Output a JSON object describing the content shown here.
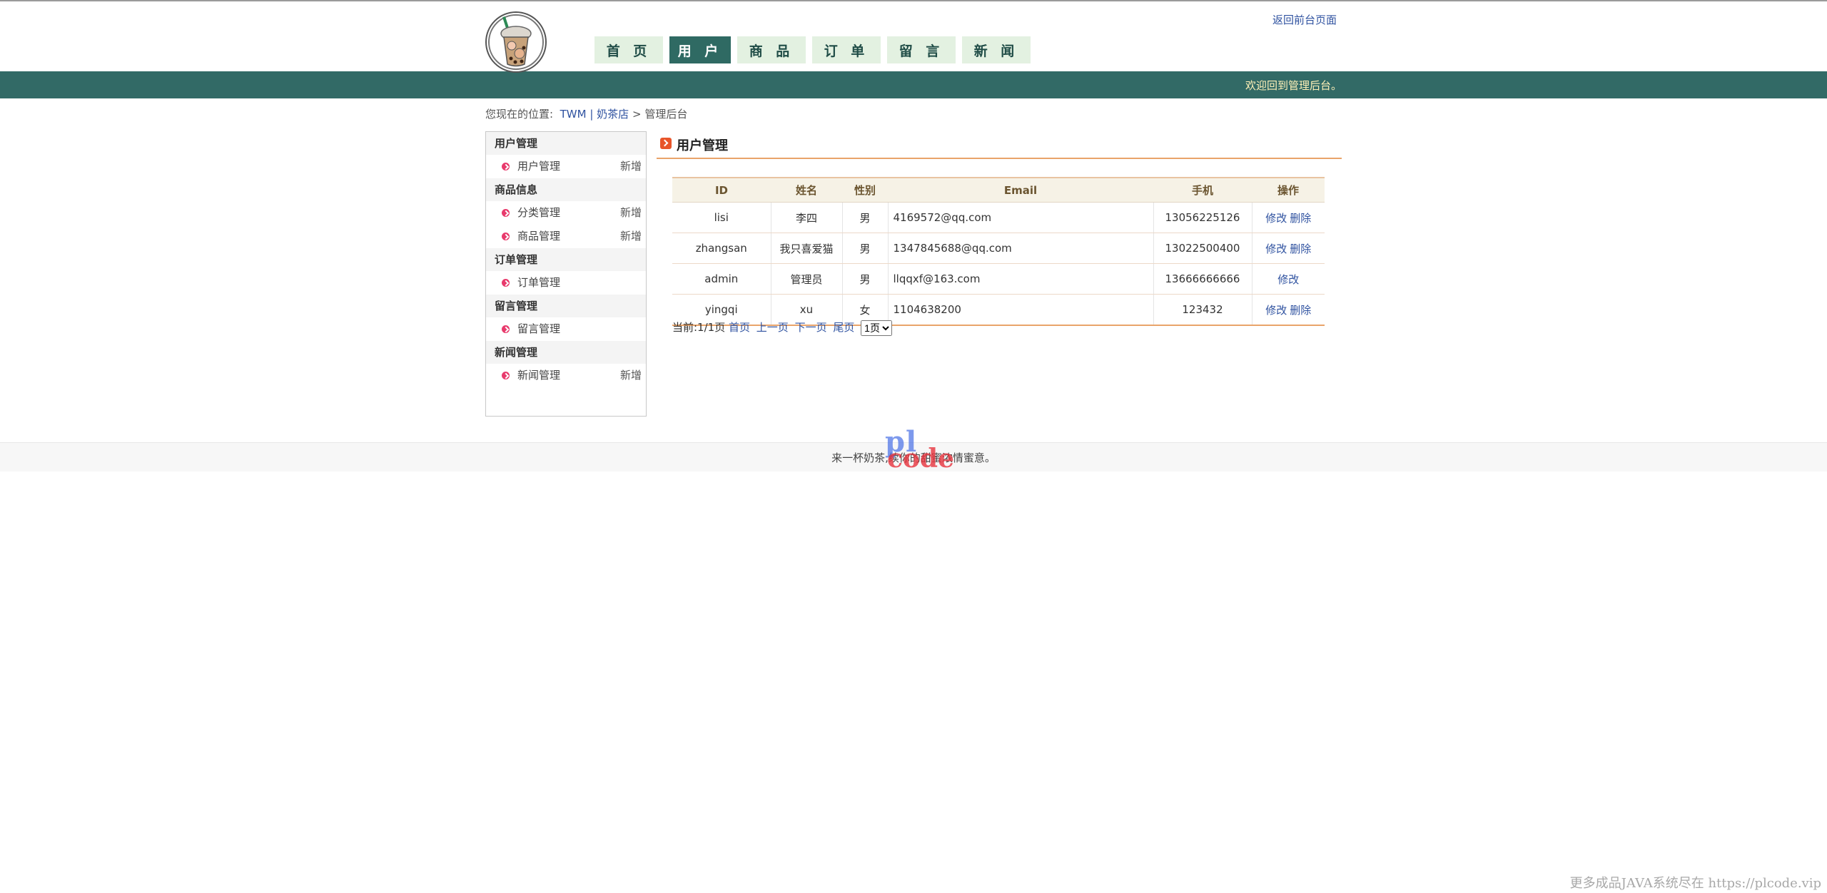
{
  "header": {
    "logo_alt": "milk tea cup logo",
    "nav": [
      {
        "label": "首 页",
        "active": false
      },
      {
        "label": "用 户",
        "active": true
      },
      {
        "label": "商 品",
        "active": false
      },
      {
        "label": "订 单",
        "active": false
      },
      {
        "label": "留 言",
        "active": false
      },
      {
        "label": "新 闻",
        "active": false
      }
    ],
    "front_link": "返回前台页面",
    "welcome": "欢迎回到管理后台。"
  },
  "breadcrumb": {
    "prefix": "您现在的位置:",
    "items": [
      "TWM",
      "|",
      "奶茶店",
      ">",
      "管理后台"
    ]
  },
  "sidebar": {
    "sections": [
      {
        "title": "用户管理",
        "items": [
          {
            "label": "用户管理",
            "add": "新增"
          }
        ]
      },
      {
        "title": "商品信息",
        "items": [
          {
            "label": "分类管理",
            "add": "新增"
          },
          {
            "label": "商品管理",
            "add": "新增"
          }
        ]
      },
      {
        "title": "订单管理",
        "items": [
          {
            "label": "订单管理",
            "add": ""
          }
        ]
      },
      {
        "title": "留言管理",
        "items": [
          {
            "label": "留言管理",
            "add": ""
          }
        ]
      },
      {
        "title": "新闻管理",
        "items": [
          {
            "label": "新闻管理",
            "add": "新增"
          }
        ]
      }
    ]
  },
  "main": {
    "title": "用户管理",
    "columns": [
      "ID",
      "姓名",
      "性别",
      "Email",
      "手机",
      "操作"
    ],
    "rows": [
      {
        "id": "lisi",
        "name": "李四",
        "gender": "男",
        "email": "4169572@qq.com",
        "phone": "13056225126",
        "actions": [
          "修改",
          "删除"
        ]
      },
      {
        "id": "zhangsan",
        "name": "我只喜爱猫",
        "gender": "男",
        "email": "1347845688@qq.com",
        "phone": "13022500400",
        "actions": [
          "修改",
          "删除"
        ]
      },
      {
        "id": "admin",
        "name": "管理员",
        "gender": "男",
        "email": "llqqxf@163.com",
        "phone": "13666666666",
        "actions": [
          "修改"
        ]
      },
      {
        "id": "yingqi",
        "name": "xu",
        "gender": "女",
        "email": "1104638200",
        "phone": "123432",
        "actions": [
          "修改",
          "删除"
        ]
      }
    ],
    "pager": {
      "status": "当前:1/1页",
      "links": [
        "首页",
        "上一页",
        "下一页",
        "尾页"
      ],
      "select_value": "1页"
    }
  },
  "footer": {
    "text": "来一杯奶茶,续你的甜蜜浓情蜜意。",
    "watermark_top": "pl",
    "watermark_bottom": "code",
    "corner": "更多成品JAVA系统尽在 https://plcode.vip"
  }
}
